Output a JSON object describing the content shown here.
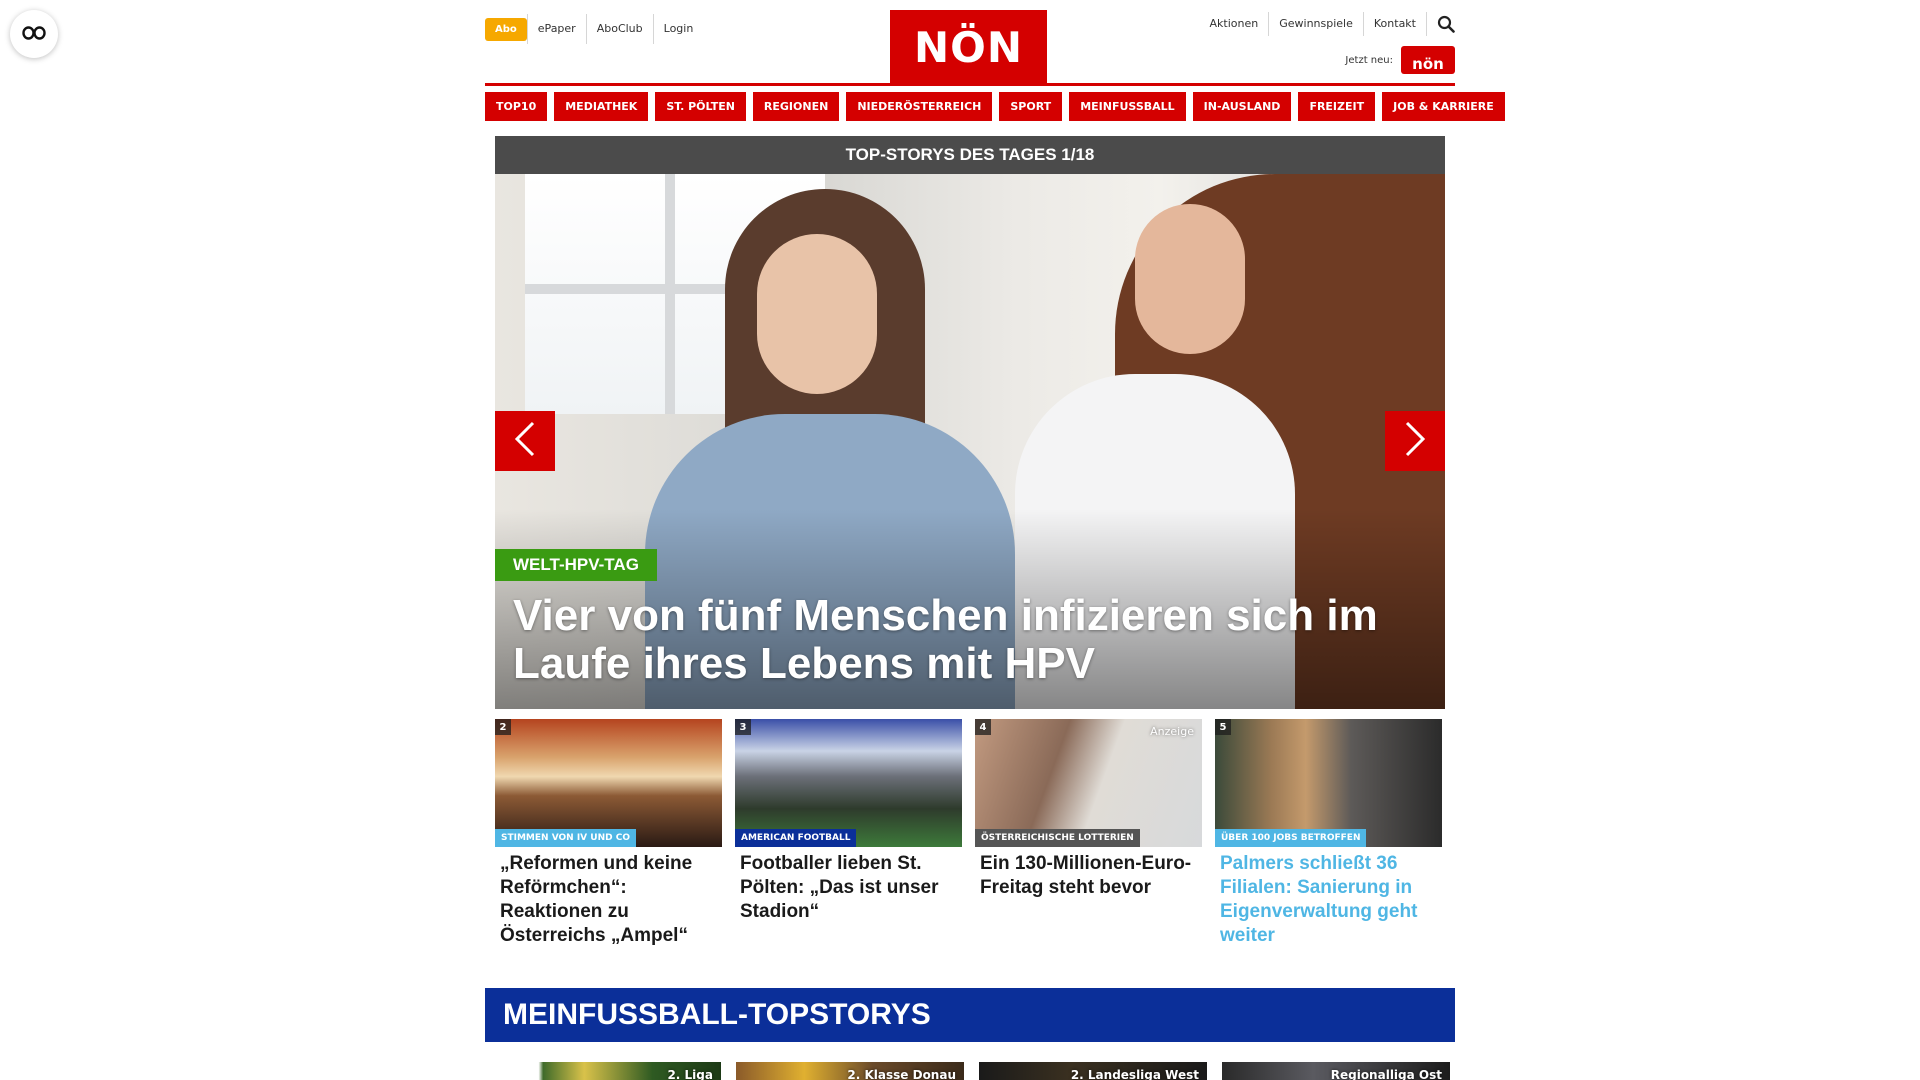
{
  "header": {
    "abo_label": "Abo",
    "left_links": [
      "ePaper",
      "AboClub",
      "Login"
    ],
    "logo_text": "NÖN",
    "right_links": [
      "Aktionen",
      "Gewinnspiele",
      "Kontakt"
    ],
    "search_icon": "search-icon",
    "jetzt_label": "Jetzt neu:",
    "mini_logo_text": "nön"
  },
  "nav": {
    "items": [
      "TOP10",
      "MEDIATHEK",
      "ST. PÖLTEN",
      "REGIONEN",
      "NIEDERÖSTERREICH",
      "SPORT",
      "MEINFUSSBALL",
      "IN-AUSLAND",
      "FREIZEIT",
      "JOB & KARRIERE"
    ]
  },
  "hero": {
    "bar_title": "TOP-STORYS DES TAGES 1/18",
    "tag": "WELT-HPV-TAG",
    "title": "Vier von fünf Menschen infizieren sich im Laufe ihres Lebens mit HPV",
    "prev_icon": "chevron-left-icon",
    "next_icon": "chevron-right-icon"
  },
  "teasers": [
    {
      "num": "2",
      "kicker": "STIMMEN VON IV UND CO",
      "kicker_color": "#4fb6e4",
      "title": "„Reformen und keine Reförmchen“: Reaktionen zu Österreichs „Ampel“",
      "anzeige": ""
    },
    {
      "num": "3",
      "kicker": "AMERICAN FOOTBALL",
      "kicker_color": "#0b2f99",
      "title": "Footballer lieben St. Pölten: „Das ist unser Stadion“",
      "anzeige": ""
    },
    {
      "num": "4",
      "kicker": "ÖSTERREICHISCHE LOTTERIEN",
      "kicker_color": "#555555",
      "title": "Ein 130-Millionen-Euro-Freitag steht bevor",
      "anzeige": "Anzeige"
    },
    {
      "num": "5",
      "kicker": "ÜBER 100 JOBS BETROFFEN",
      "kicker_color": "#4fb6e4",
      "title": "Palmers schließt 36 Filialen: Sanierung in Eigenverwaltung geht weiter",
      "anzeige": ""
    }
  ],
  "section": {
    "title": "MEINFUSSBALL-TOPSTORYS",
    "cards": [
      "2. Liga",
      "2. Klasse Donau",
      "2. Landesliga West",
      "Regionalliga Ost"
    ]
  },
  "colors": {
    "brand_red": "#d40000",
    "abo_orange": "#f6a800",
    "hero_tag_green": "#3a9b12",
    "section_blue": "#0b2f99",
    "highlight_blue": "#4fb6e4"
  },
  "reader_icon": "reader-mode-icon"
}
